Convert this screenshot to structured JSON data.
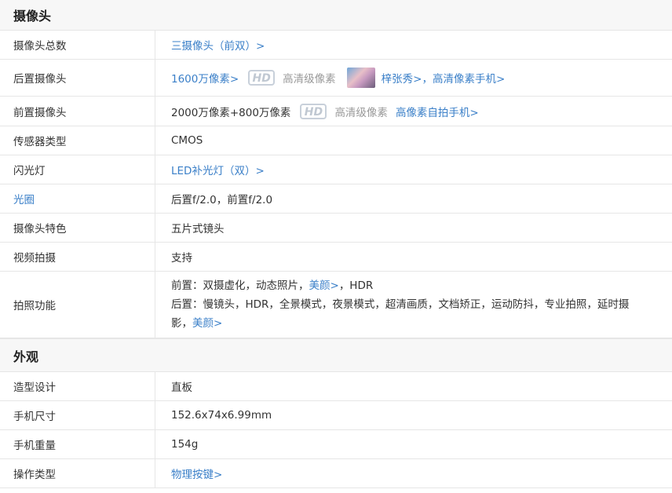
{
  "sections": {
    "camera": {
      "title": "摄像头",
      "rows": {
        "total": {
          "label": "摄像头总数",
          "value_link": "三摄像头（前双）>"
        },
        "rear": {
          "label": "后置摄像头",
          "value_link": "1600万像素>",
          "hd": "HD",
          "hd_text": "高清级像素",
          "extra_link": "梓张秀>，高清像素手机>"
        },
        "front": {
          "label": "前置摄像头",
          "value": "2000万像素+800万像素",
          "hd": "HD",
          "hd_text": "高清级像素",
          "extra_link": "高像素自拍手机>"
        },
        "sensor": {
          "label": "传感器类型",
          "value": "CMOS"
        },
        "flash": {
          "label": "闪光灯",
          "value_link": "LED补光灯（双）>"
        },
        "aperture": {
          "label": "光圈",
          "value": "后置f/2.0，前置f/2.0"
        },
        "feature": {
          "label": "摄像头特色",
          "value": "五片式镜头"
        },
        "video": {
          "label": "视频拍摄",
          "value": "支持"
        },
        "photo": {
          "label": "拍照功能",
          "line1_prefix": "前置：双摄虚化，动态照片，",
          "line1_link": "美颜>",
          "line1_suffix": "，HDR",
          "line2": "后置：慢镜头，HDR，全景模式，夜景模式，超清画质，文档矫正，运动防抖，专业拍照，延时摄",
          "line3_prefix": "影，",
          "line3_link": "美颜>"
        }
      }
    },
    "appearance": {
      "title": "外观",
      "rows": {
        "design": {
          "label": "造型设计",
          "value": "直板"
        },
        "size": {
          "label": "手机尺寸",
          "value": "152.6x74x6.99mm"
        },
        "weight": {
          "label": "手机重量",
          "value": "154g"
        },
        "operation": {
          "label": "操作类型",
          "value_link": "物理按键>"
        }
      }
    }
  }
}
